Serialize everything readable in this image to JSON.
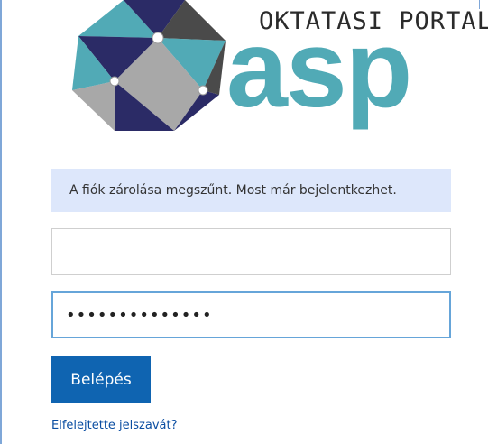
{
  "logo": {
    "title": "OKTATASI PORTAL",
    "wordmark": "asp",
    "colors": {
      "teal": "#51aab6",
      "navy": "#2b2b66",
      "gray": "#a8a8a8",
      "dark": "#4a4a4a"
    }
  },
  "alert": {
    "message": "A fiók zárolása megszűnt. Most már bejelentkezhet."
  },
  "form": {
    "username_value": "",
    "password_value": "••••••••••••••",
    "login_label": "Belépés",
    "forgot_label": "Elfelejtette jelszavát?"
  },
  "colors": {
    "accent": "#0f64b1",
    "alert_bg": "#dde7fb",
    "focus_border": "#66a5d9",
    "link": "#0b4ea2"
  }
}
